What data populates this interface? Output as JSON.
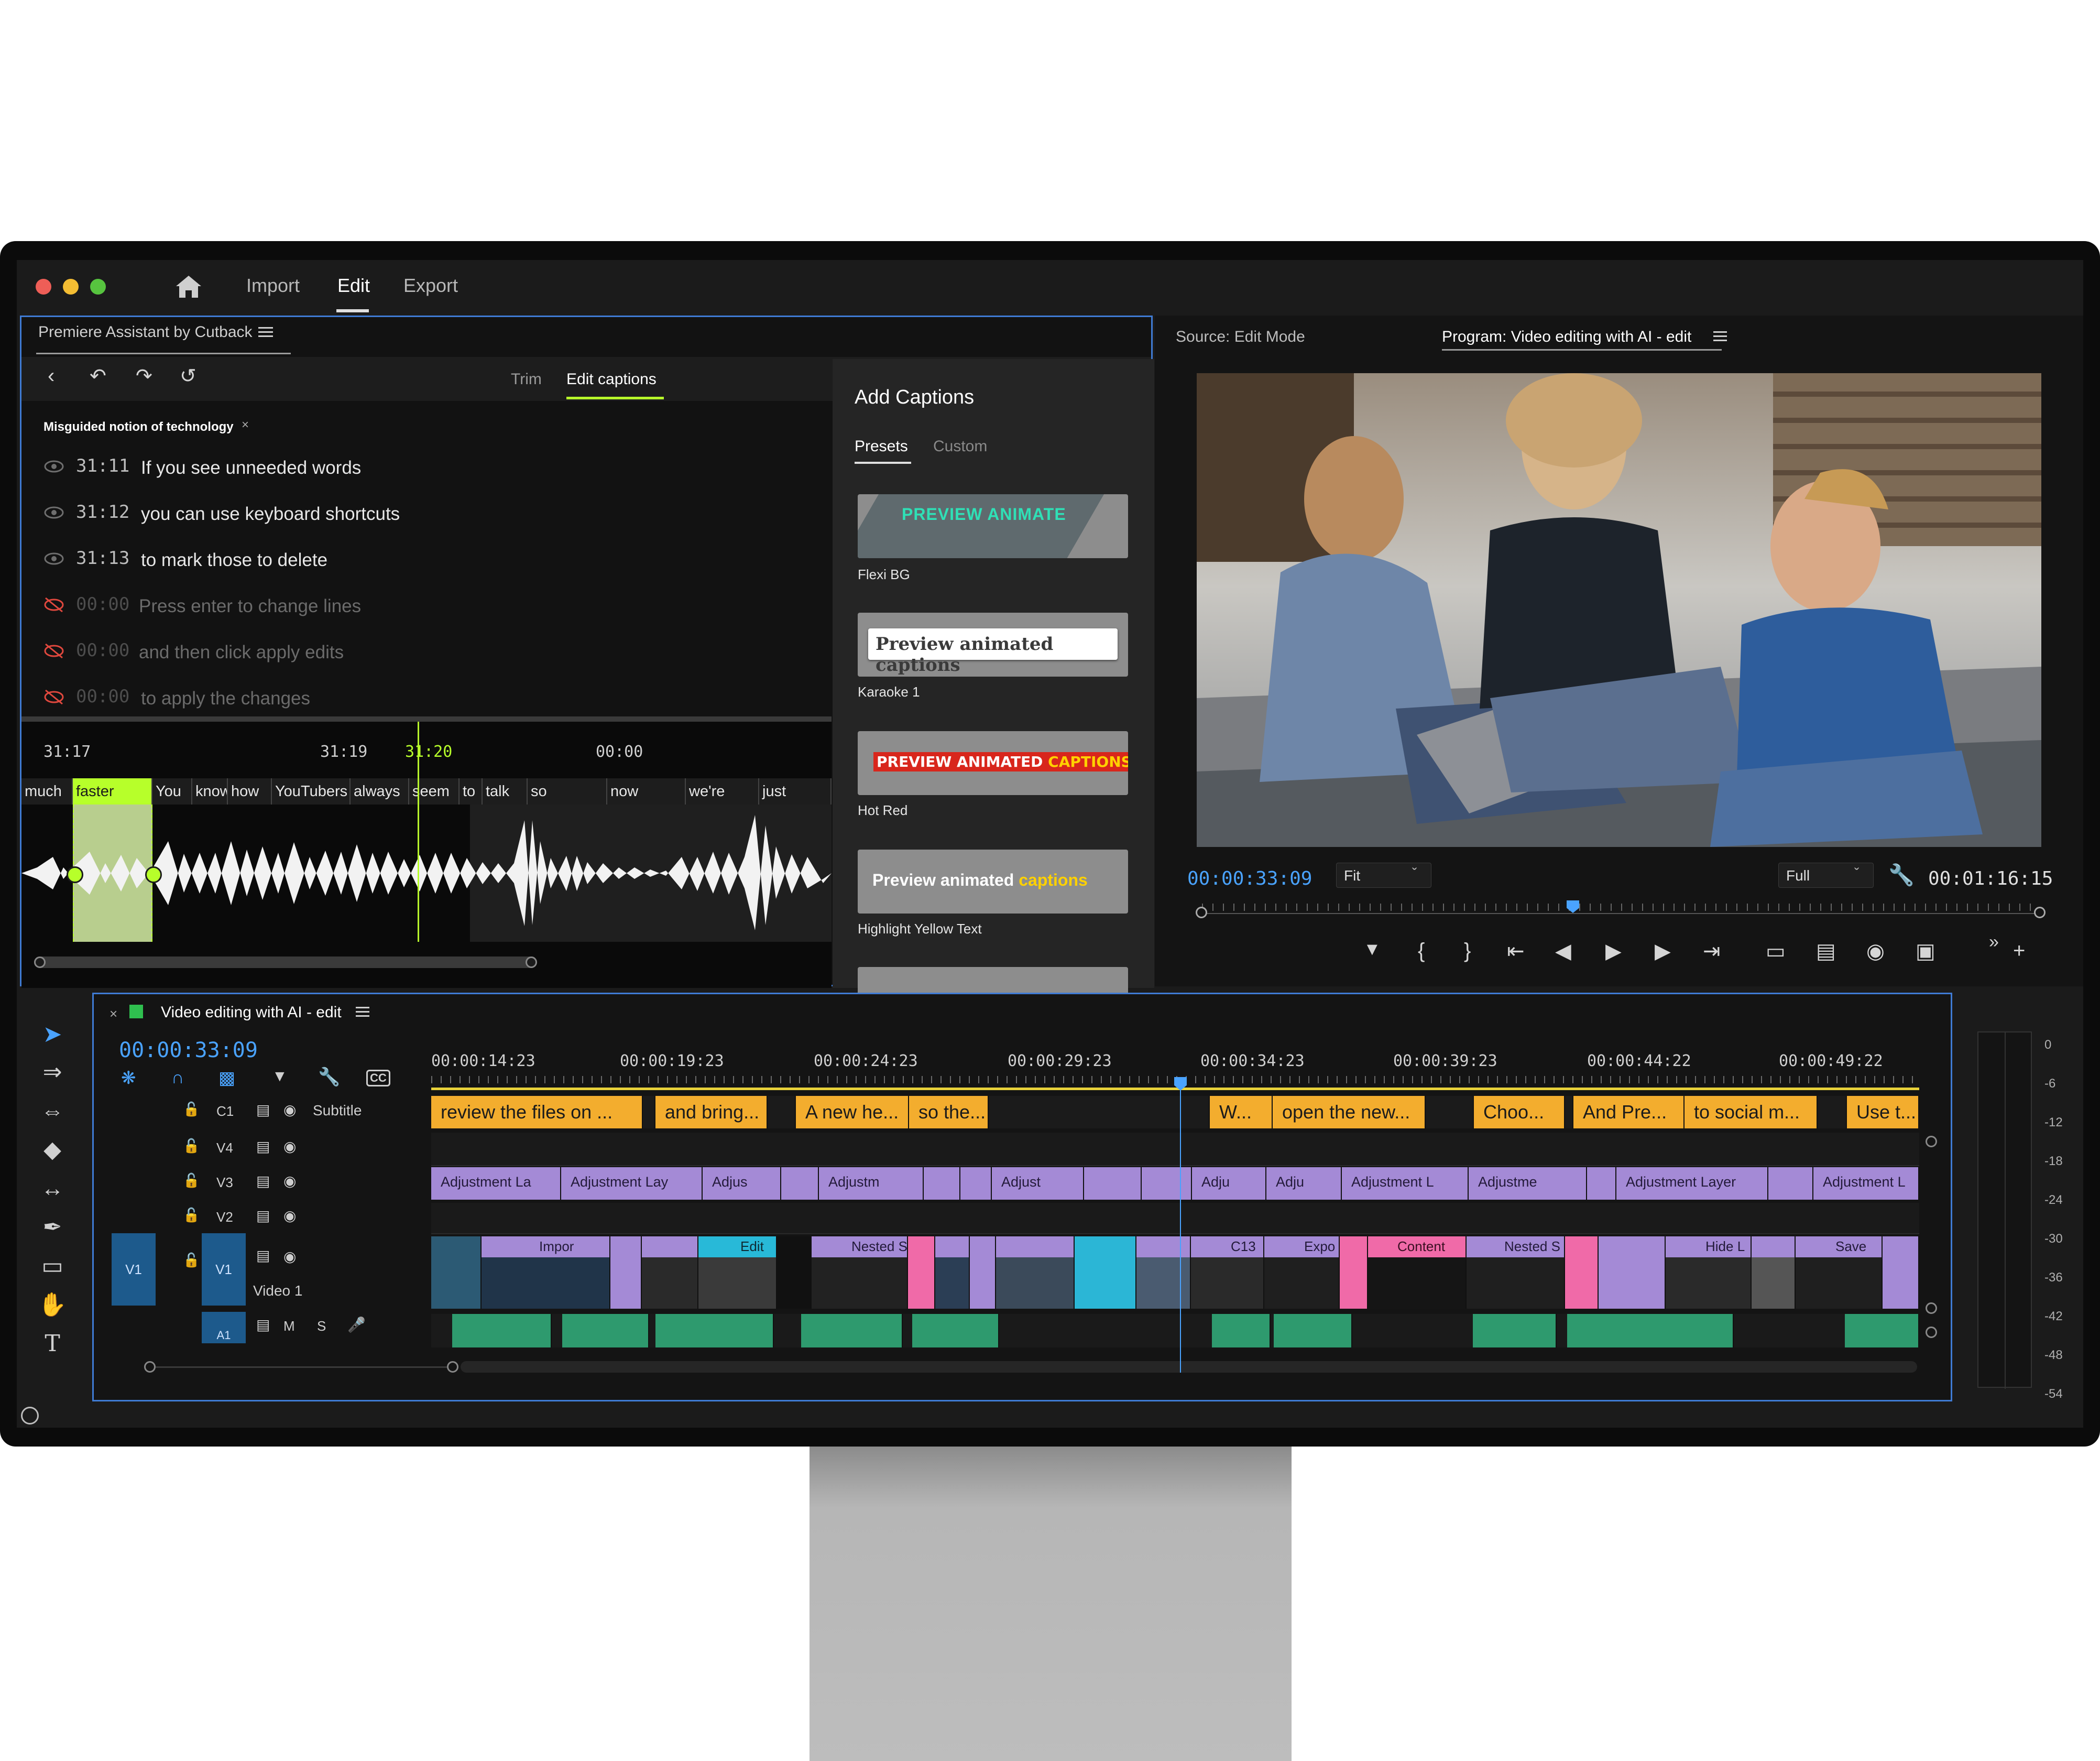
{
  "nav": {
    "import": "Import",
    "edit": "Edit",
    "export": "Export"
  },
  "assistant": {
    "title": "Premiere Assistant by Cutback",
    "tab_trim": "Trim",
    "tab_edit": "Edit captions",
    "section": "Misguided notion of technology",
    "lines": [
      {
        "time": "31:11",
        "text": "If you see unneeded words",
        "hidden": false
      },
      {
        "time": "31:12",
        "text": "you can use keyboard shortcuts",
        "hidden": false
      },
      {
        "time": "31:13",
        "text": "to mark those to delete",
        "hidden": false
      },
      {
        "time": "00:00",
        "text": "Press enter to change lines",
        "hidden": true
      },
      {
        "time": "00:00",
        "text": "and then click apply edits",
        "hidden": true
      },
      {
        "time": "00:00",
        "text": "to apply the changes",
        "hidden": true
      }
    ],
    "wave_times": [
      "31:17",
      "31:19",
      "31:20",
      "00:00"
    ],
    "words": [
      "much",
      "faster",
      "You",
      "know",
      "how",
      "YouTubers",
      "always",
      "seem",
      "to",
      "talk",
      "so",
      "now",
      "we're",
      "just"
    ]
  },
  "captions": {
    "title": "Add Captions",
    "tab_presets": "Presets",
    "tab_custom": "Custom",
    "presets": [
      {
        "name": "Flexi BG",
        "preview": "PREVIEW ANIMATE"
      },
      {
        "name": "Karaoke 1",
        "preview": "Preview animated captions"
      },
      {
        "name": "Hot Red",
        "preview_a": "PREVIEW ANIMATED ",
        "preview_b": "CAPTIONS"
      },
      {
        "name": "Highlight Yellow Text",
        "preview_a": "Preview animated ",
        "preview_b": "captions"
      }
    ]
  },
  "program": {
    "source_label": "Source: Edit Mode",
    "program_label": "Program: Video editing with AI - edit",
    "timecode": "00:00:33:09",
    "fit": "Fit",
    "full": "Full",
    "duration": "00:01:16:15"
  },
  "timeline": {
    "sequence": "Video editing with AI - edit",
    "timecode": "00:00:33:09",
    "ruler": [
      "00:00:14:23",
      "00:00:19:23",
      "00:00:24:23",
      "00:00:29:23",
      "00:00:34:23",
      "00:00:39:23",
      "00:00:44:22",
      "00:00:49:22"
    ],
    "tracks": {
      "c1": "C1",
      "subtitle": "Subtitle",
      "v4": "V4",
      "v3": "V3",
      "v2": "V2",
      "v1": "V1",
      "video1": "Video 1",
      "a1": "A1",
      "m": "M",
      "s": "S"
    },
    "subtitles": [
      "review the files on ...",
      "and bring...",
      "A new he...",
      "so the...",
      "W...",
      "open the new...",
      "Choo...",
      "And Pre...",
      "to social m...",
      "Use t..."
    ],
    "adjustments": [
      "Adjustment La",
      "Adjustment Lay",
      "Adjus",
      "Adjustm",
      "Adjust",
      "Adju",
      "Adju",
      "Adjustment L",
      "Adjustme",
      "Adjustment Layer",
      "Adjustment L"
    ],
    "v1_clips": [
      "Impor",
      "Edit",
      "Nested S",
      "C13",
      "Expo",
      "Content",
      "Nested S",
      "Hide L",
      "Save"
    ]
  },
  "meter": {
    "scale": [
      "0",
      "-6",
      "-12",
      "-18",
      "-24",
      "-30",
      "-36",
      "-42",
      "-48",
      "-54"
    ]
  },
  "colors": {
    "accent_blue": "#3f7bd4",
    "timecode_blue": "#4aa3ff",
    "subtitle": "#f3ad2e",
    "adjustment": "#a48ad6",
    "audio": "#2e9a6e",
    "highlight": "#b7ff2a"
  }
}
